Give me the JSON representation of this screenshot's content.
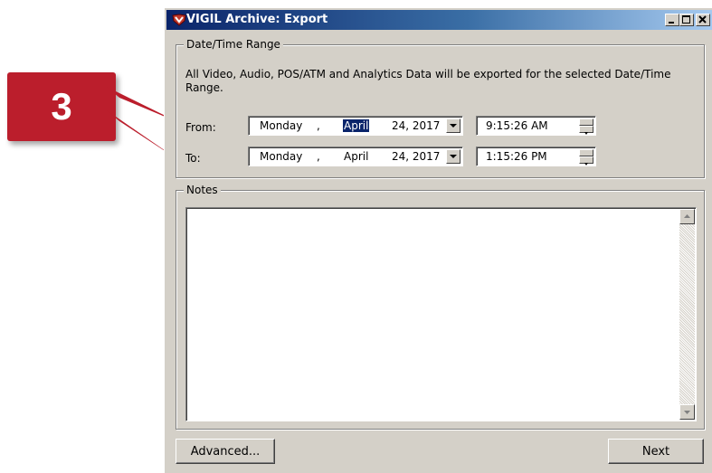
{
  "annotation": {
    "step_number": "3",
    "color": "#bb1e2c"
  },
  "window": {
    "title": "VIGIL Archive: Export",
    "icon": "vigil-app-icon",
    "controls": [
      "minimize-icon",
      "maximize-icon",
      "close-icon"
    ]
  },
  "date_time_range": {
    "legend": "Date/Time Range",
    "description": "All Video, Audio, POS/ATM and Analytics Data will be exported for the selected Date/Time Range.",
    "from": {
      "label": "From:",
      "weekday": "Monday",
      "sep": ",",
      "month": "April",
      "day_year": "24, 2017",
      "time": "9:15:26 AM"
    },
    "to": {
      "label": "To:",
      "weekday": "Monday",
      "sep": ",",
      "month": "April",
      "day_year": "24, 2017",
      "time": "1:15:26 PM"
    }
  },
  "notes": {
    "legend": "Notes",
    "value": ""
  },
  "buttons": {
    "advanced": "Advanced...",
    "next": "Next"
  },
  "colors": {
    "dialog_bg": "#d4d0c8",
    "title_start": "#0a246a",
    "title_end": "#a6caf0",
    "selection": "#0a246a"
  }
}
